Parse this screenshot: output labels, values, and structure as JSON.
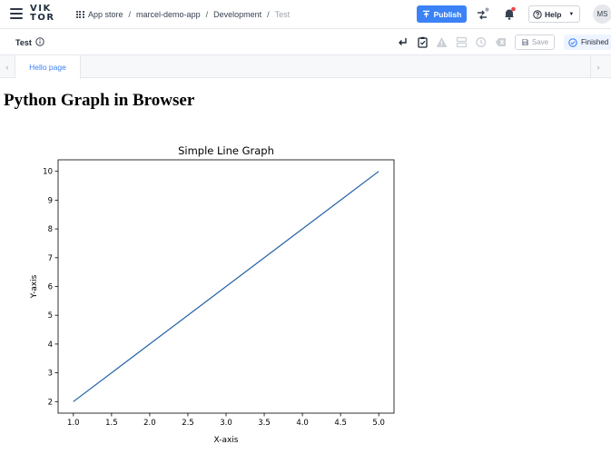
{
  "header": {
    "logo_line1": "VIK",
    "logo_line2": "TOR",
    "breadcrumbs": [
      {
        "label": "App store"
      },
      {
        "label": "marcel-demo-app"
      },
      {
        "label": "Development"
      },
      {
        "label": "Test"
      }
    ],
    "separator": "/",
    "publish_label": "Publish",
    "help_label": "Help",
    "avatar_initials": "MS",
    "accent_color": "#3b82f6",
    "notification_color": "#ef4444"
  },
  "toolbar": {
    "entity_name": "Test",
    "save_label": "Save",
    "status_label": "Finished"
  },
  "tabs": [
    {
      "label": "Hello page",
      "active": true
    }
  ],
  "content": {
    "heading": "Python Graph in Browser"
  },
  "chart_data": {
    "type": "line",
    "title": "Simple Line Graph",
    "xlabel": "X-axis",
    "ylabel": "Y-axis",
    "x": [
      1.0,
      5.0
    ],
    "series": [
      {
        "values": [
          2,
          10
        ],
        "color": "#1f5fa6"
      }
    ],
    "xlim": [
      0.8,
      5.2
    ],
    "ylim": [
      1.6,
      10.4
    ],
    "xticks": [
      "1.0",
      "1.5",
      "2.0",
      "2.5",
      "3.0",
      "3.5",
      "4.0",
      "4.5",
      "5.0"
    ],
    "yticks": [
      "2",
      "3",
      "4",
      "5",
      "6",
      "7",
      "8",
      "9",
      "10"
    ],
    "grid": false
  }
}
